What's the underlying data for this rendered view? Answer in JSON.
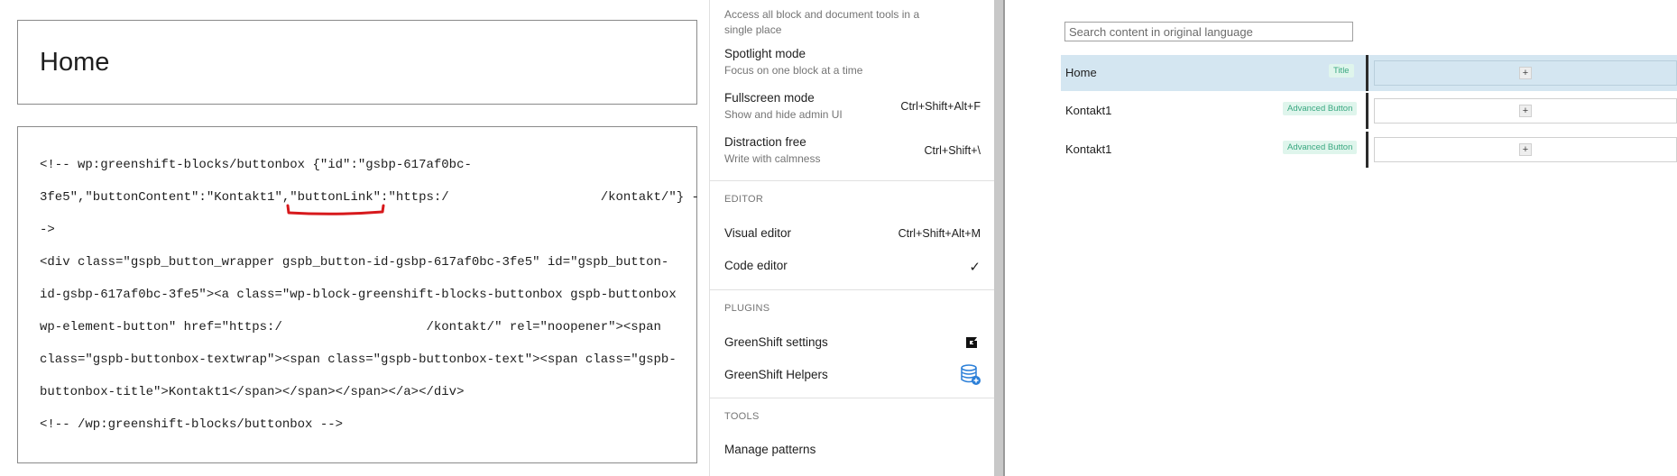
{
  "editor": {
    "title": "Home",
    "code_lines": [
      "<!-- wp:greenshift-blocks/buttonbox {\"id\":\"gsbp-617af0bc-",
      "3fe5\",\"buttonContent\":\"Kontakt1\",\"buttonLink\":\"https:/                    /kontakt/\"} -",
      "->",
      "<div class=\"gspb_button_wrapper gspb_button-id-gsbp-617af0bc-3fe5\" id=\"gspb_button-",
      "id-gsbp-617af0bc-3fe5\"><a class=\"wp-block-greenshift-blocks-buttonbox gspb-buttonbox",
      "wp-element-button\" href=\"https:/                   /kontakt/\" rel=\"noopener\"><span",
      "class=\"gspb-buttonbox-textwrap\"><span class=\"gspb-buttonbox-text\"><span class=\"gspb-",
      "buttonbox-title\">Kontakt1</span></span></span></a></div>",
      "<!-- /wp:greenshift-blocks/buttonbox -->"
    ],
    "annotation_color": "#d7191c"
  },
  "menu": {
    "top_description": "Access all block and document tools in a single place",
    "view_items": [
      {
        "label": "Spotlight mode",
        "description": "Focus on one block at a time",
        "shortcut": ""
      },
      {
        "label": "Fullscreen mode",
        "description": "Show and hide admin UI",
        "shortcut": "Ctrl+Shift+Alt+F"
      },
      {
        "label": "Distraction free",
        "description": "Write with calmness",
        "shortcut": "Ctrl+Shift+\\"
      }
    ],
    "editor_heading": "EDITOR",
    "editor_items": [
      {
        "label": "Visual editor",
        "shortcut": "Ctrl+Shift+Alt+M"
      },
      {
        "label": "Code editor",
        "shortcut": "✓"
      }
    ],
    "plugins_heading": "PLUGINS",
    "plugin_items": [
      {
        "label": "GreenShift settings",
        "icon": "greenshift-logo-icon"
      },
      {
        "label": "GreenShift Helpers",
        "icon": "database-plus-icon"
      }
    ],
    "tools_heading": "TOOLS",
    "tool_items": [
      {
        "label": "Manage patterns"
      }
    ]
  },
  "translation": {
    "search_placeholder": "Search content in original language",
    "rows": [
      {
        "name": "Home",
        "badge": "Title",
        "active": true
      },
      {
        "name": "Kontakt1",
        "badge": "Advanced Button",
        "active": false
      },
      {
        "name": "Kontakt1",
        "badge": "Advanced Button",
        "active": false
      }
    ],
    "add_symbol": "+",
    "accent_active": "#d4e6f1",
    "badge_color": "#3aa881"
  }
}
